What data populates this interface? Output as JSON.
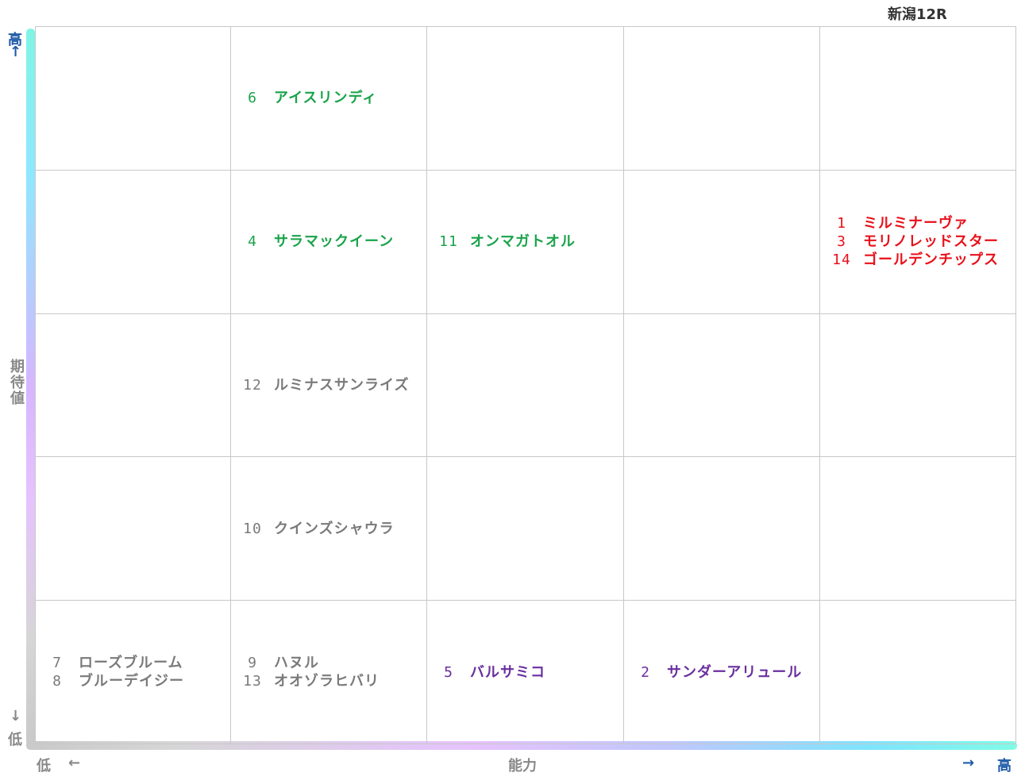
{
  "race": "新潟12R",
  "axis": {
    "y_high": "高",
    "y_high_arrow": "↑",
    "y_label": "期待値",
    "y_low": "低",
    "y_low_arrow": "↓",
    "x_low": "低",
    "x_low_arrow": "←",
    "x_label": "能力",
    "x_high": "高",
    "x_high_arrow": "→"
  },
  "cells": {
    "r1c2": [
      {
        "num": "6",
        "name": "アイスリンディ"
      }
    ],
    "r2c2": [
      {
        "num": "4",
        "name": "サラマックイーン"
      }
    ],
    "r2c3": [
      {
        "num": "11",
        "name": "オンマガトオル"
      }
    ],
    "r2c5": [
      {
        "num": "1",
        "name": "ミルミナーヴァ"
      },
      {
        "num": "3",
        "name": "モリノレッドスター"
      },
      {
        "num": "14",
        "name": "ゴールデンチップス"
      }
    ],
    "r3c2": [
      {
        "num": "12",
        "name": "ルミナスサンライズ"
      }
    ],
    "r4c2": [
      {
        "num": "10",
        "name": "クインズシャウラ"
      }
    ],
    "r5c1": [
      {
        "num": "7",
        "name": "ローズブルーム"
      },
      {
        "num": "8",
        "name": "ブルーデイジー"
      }
    ],
    "r5c2": [
      {
        "num": "9",
        "name": "ハヌル"
      },
      {
        "num": "13",
        "name": "オオゾラヒバリ"
      }
    ],
    "r5c3": [
      {
        "num": "5",
        "name": "バルサミコ"
      }
    ],
    "r5c4": [
      {
        "num": "2",
        "name": "サンダーアリュール"
      }
    ]
  },
  "colors": {
    "green": "#1aa34a",
    "red": "#e8101a",
    "gray": "#7a7a7a",
    "purple": "#6a2f9e",
    "axis_blue": "#1f5ba8"
  }
}
